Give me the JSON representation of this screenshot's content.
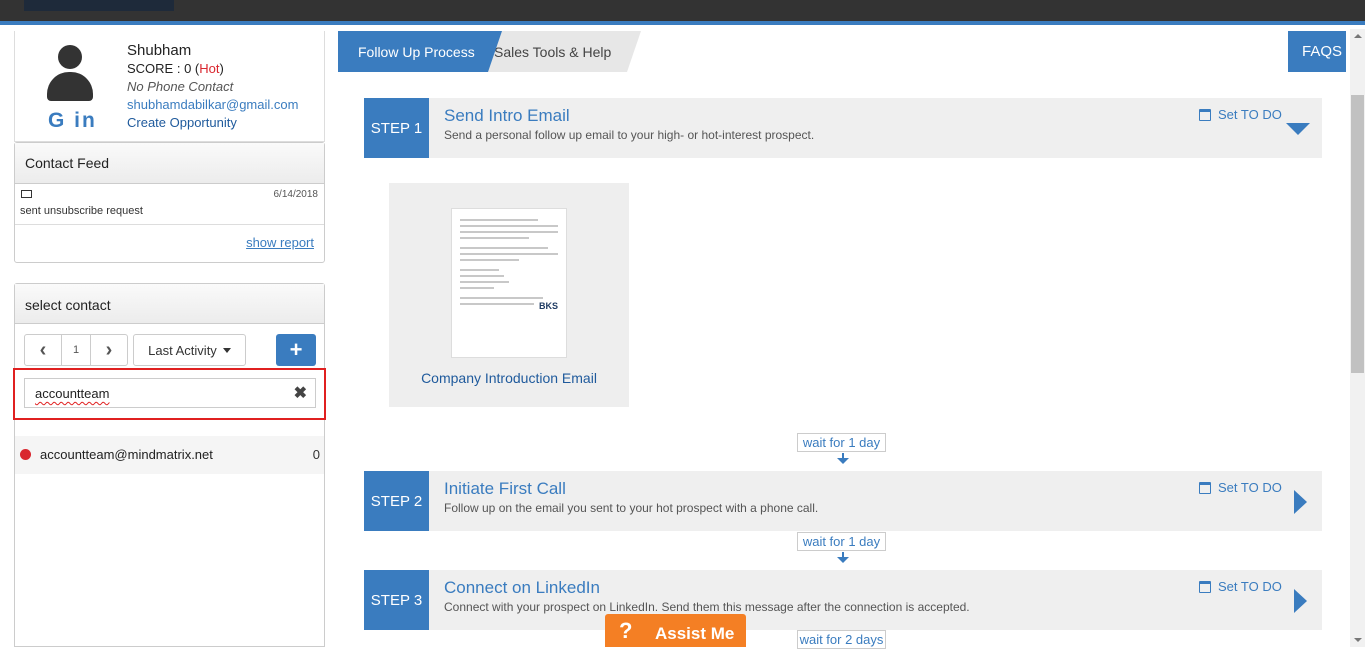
{
  "profile": {
    "name": "Shubham",
    "score_label": "SCORE : 0 (",
    "score_hot": "Hot",
    "score_close": ")",
    "phone": "No Phone Contact",
    "email": "shubhamdabilkar@gmail.com",
    "create_opportunity": "Create Opportunity",
    "social": "G in"
  },
  "contact_feed": {
    "title": "Contact Feed",
    "items": [
      {
        "icon": "monitor-icon",
        "date": "6/14/2018",
        "text": "sent unsubscribe request"
      }
    ],
    "show_report": "show report"
  },
  "select_contact": {
    "title": "select contact",
    "page": "1",
    "sort_label": "Last Activity",
    "search_value": "accountteam",
    "results": [
      {
        "email": "accountteam@mindmatrix.net",
        "count": "0",
        "status_color": "#d9262e"
      }
    ]
  },
  "tabs": {
    "follow_up": "Follow Up Process",
    "sales_tools": "Sales Tools & Help",
    "faqs": "FAQS"
  },
  "steps": [
    {
      "num": "STEP 1",
      "title": "Send Intro Email",
      "desc": "Send a personal follow up email to your high- or hot-interest prospect.",
      "todo": "Set TO DO",
      "expanded": true
    },
    {
      "num": "STEP 2",
      "title": "Initiate First Call",
      "desc": "Follow up on the email you sent to your hot prospect with a phone call.",
      "todo": "Set TO DO",
      "expanded": false
    },
    {
      "num": "STEP 3",
      "title": "Connect on LinkedIn",
      "desc": "Connect with your prospect on LinkedIn. Send them this message after the connection is accepted.",
      "todo": "Set TO DO",
      "expanded": false
    }
  ],
  "email_card": {
    "caption": "Company Introduction Email",
    "thumb_logo": "BKS"
  },
  "waits": [
    "wait for 1 day",
    "wait for 1 day",
    "wait for 2 days"
  ],
  "assist": {
    "icon": "?",
    "label": "Assist Me"
  },
  "colors": {
    "accent": "#3a7cbf",
    "hot": "#d9262e",
    "assist": "#f47f24",
    "highlight": "#e02020"
  }
}
